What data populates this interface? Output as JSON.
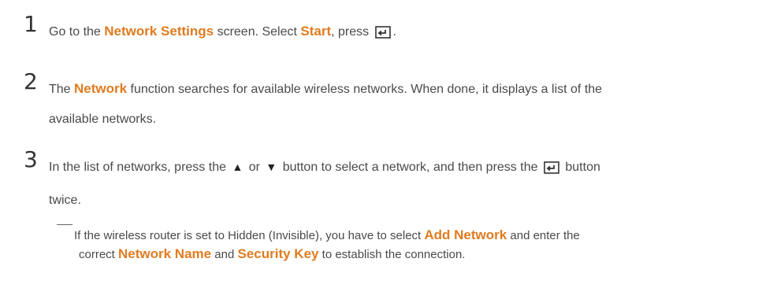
{
  "steps": [
    {
      "number": "1",
      "parts": {
        "a": "Go to the ",
        "b": "Network Settings",
        "c": " screen. Select ",
        "d": "Start",
        "e": ", press ",
        "f": "."
      },
      "icons": [
        "enter-icon"
      ]
    },
    {
      "number": "2",
      "parts": {
        "a": "The ",
        "b": "Network",
        "c": " function searches for available wireless networks. When done, it displays a list of the",
        "d": "available networks."
      }
    },
    {
      "number": "3",
      "parts": {
        "a": "In the list of networks, press the ",
        "b": " or ",
        "c": " button to select a network, and then press the ",
        "d": " button",
        "e": "twice."
      },
      "icons": [
        "up-triangle-icon",
        "down-triangle-icon",
        "enter-icon"
      ]
    }
  ],
  "note": {
    "a": "If the wireless router is set to Hidden (Invisible), you have to select ",
    "b": "Add Network",
    "c": " and enter the",
    "d": "correct ",
    "e": "Network Name",
    "f": " and ",
    "g": "Security Key",
    "h": " to establish the connection."
  },
  "colors": {
    "highlight": "#e07b1f",
    "text": "#4a4a4a"
  }
}
